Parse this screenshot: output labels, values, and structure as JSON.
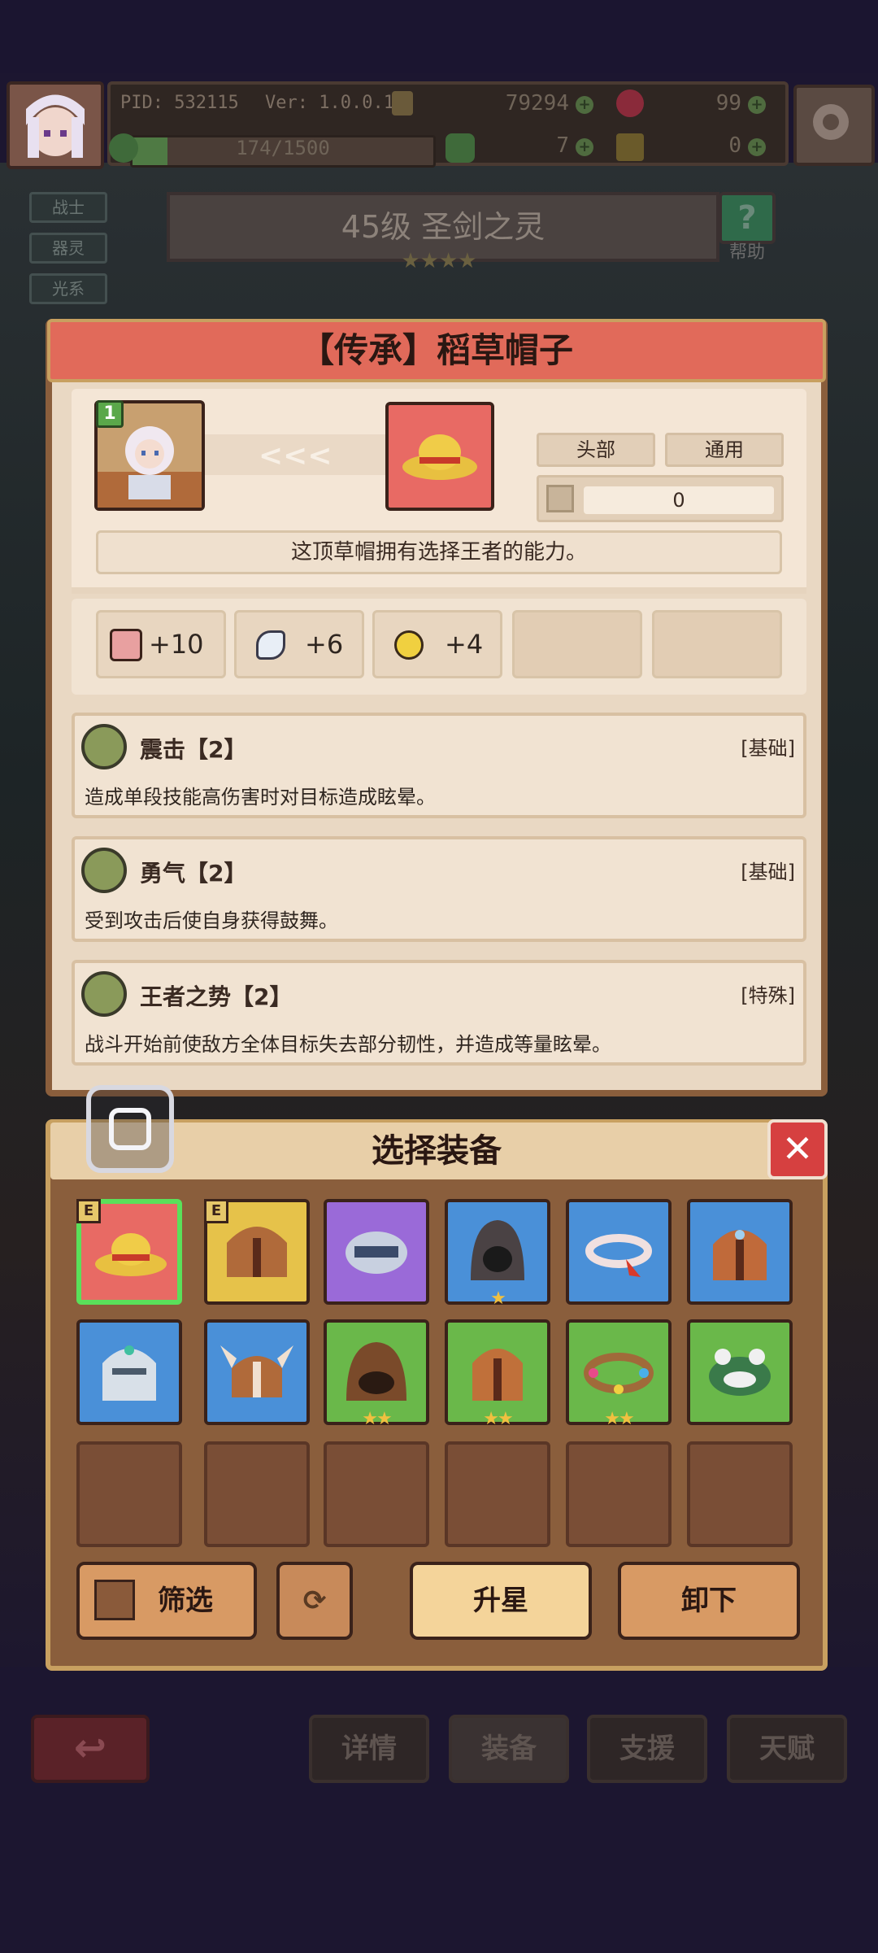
{
  "status": {
    "pid": "PID: 532115",
    "ver": "Ver: 1.0.0.10",
    "gold": "79294",
    "gems": "99",
    "clover": "7",
    "keys": "0",
    "xp": "174/1500",
    "xp_progress": 0.116
  },
  "side_tags": [
    "战士",
    "器灵",
    "光系"
  ],
  "hero": {
    "level_name": "45级 圣剑之灵",
    "stars": 4,
    "help": "帮助"
  },
  "item_detail": {
    "title": "【传承】稻草帽子",
    "hero_level_badge": "1",
    "slot_type": "头部",
    "class_type": "通用",
    "score": "0",
    "description": "这顶草帽拥有选择王者的能力。",
    "stats": [
      {
        "icon": "fist-icon",
        "value": "+10"
      },
      {
        "icon": "wing-icon",
        "value": "+6"
      },
      {
        "icon": "clock-icon",
        "value": "+4"
      }
    ],
    "skills": [
      {
        "name": "震击【2】",
        "tag": "[基础]",
        "desc": "造成单段技能高伤害时对目标造成眩晕。"
      },
      {
        "name": "勇气【2】",
        "tag": "[基础]",
        "desc": "受到攻击后使自身获得鼓舞。"
      },
      {
        "name": "王者之势【2】",
        "tag": "[特殊]",
        "desc": "战斗开始前使敌方全体目标失去部分韧性，并造成等量眩晕。"
      }
    ]
  },
  "select_panel": {
    "title": "选择装备",
    "buttons": {
      "filter": "筛选",
      "upgrade": "升星",
      "unequip": "卸下"
    },
    "equip_badge": "E",
    "items": [
      {
        "name": "straw-hat",
        "bg": "#e86a64",
        "equipped": true,
        "selected": true,
        "stars": 0
      },
      {
        "name": "bronze-helmet",
        "bg": "#e6c24a",
        "equipped": true,
        "selected": false,
        "stars": 0
      },
      {
        "name": "purple-visor",
        "bg": "#9a6ad8",
        "equipped": false,
        "selected": false,
        "stars": 0
      },
      {
        "name": "dark-hood",
        "bg": "#4a90d8",
        "equipped": false,
        "selected": false,
        "stars": 1
      },
      {
        "name": "headband",
        "bg": "#4a90d8",
        "equipped": false,
        "selected": false,
        "stars": 0
      },
      {
        "name": "copper-helm",
        "bg": "#4a90d8",
        "equipped": false,
        "selected": false,
        "stars": 0
      },
      {
        "name": "knight-helm",
        "bg": "#4a90d8",
        "equipped": false,
        "selected": false,
        "stars": 0
      },
      {
        "name": "viking-helm",
        "bg": "#4a90d8",
        "equipped": false,
        "selected": false,
        "stars": 0
      },
      {
        "name": "leather-hood",
        "bg": "#6ab84a",
        "equipped": false,
        "selected": false,
        "stars": 2
      },
      {
        "name": "iron-helm",
        "bg": "#6ab84a",
        "equipped": false,
        "selected": false,
        "stars": 2
      },
      {
        "name": "flower-wreath",
        "bg": "#6ab84a",
        "equipped": false,
        "selected": false,
        "stars": 2
      },
      {
        "name": "frog-hat",
        "bg": "#6ab84a",
        "equipped": false,
        "selected": false,
        "stars": 0
      }
    ]
  },
  "bottom_nav": [
    "详情",
    "装备",
    "支援",
    "天赋"
  ]
}
